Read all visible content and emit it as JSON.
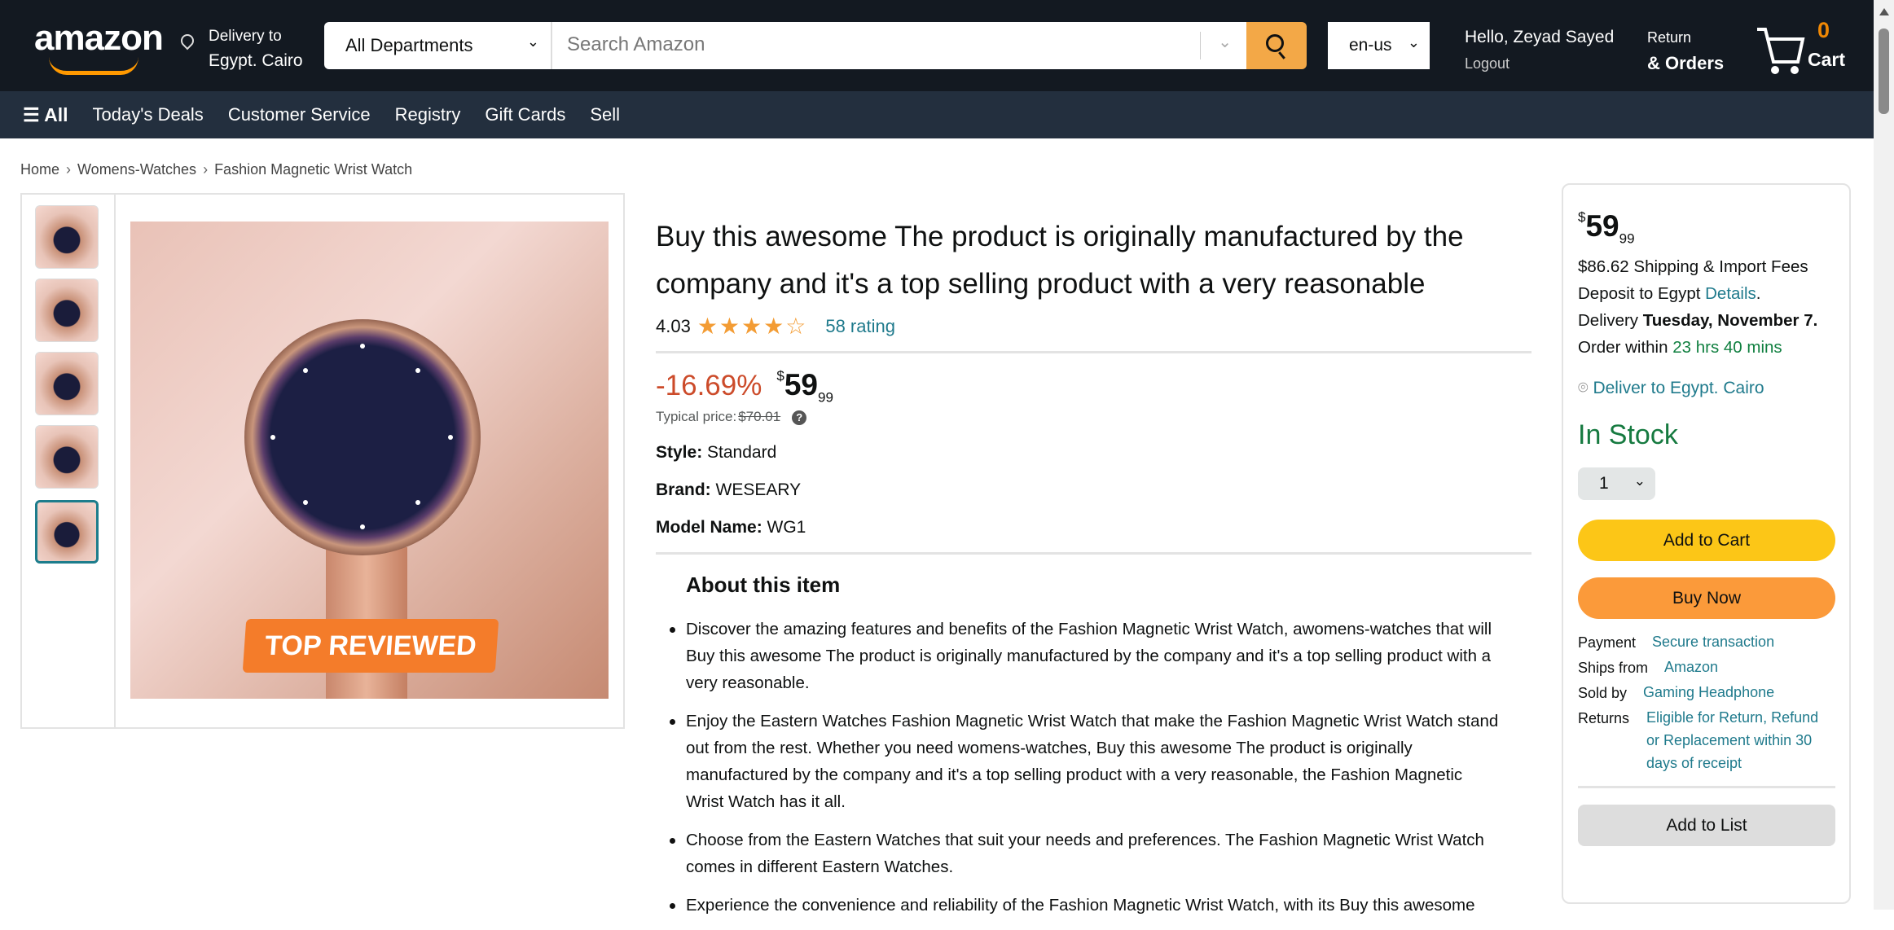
{
  "header": {
    "logo": "amazon",
    "delivery_line1": "Delivery to",
    "delivery_line2": "Egypt. Cairo",
    "department": "All Departments",
    "search_placeholder": "Search Amazon",
    "language": "en-us",
    "greeting": "Hello, Zeyad Sayed",
    "logout": "Logout",
    "returns_line1": "Return",
    "returns_line2": "& Orders",
    "cart_count": "0",
    "cart_label": "Cart"
  },
  "nav": {
    "all": "☰ All",
    "items": [
      "Today's Deals",
      "Customer Service",
      "Registry",
      "Gift Cards",
      "Sell"
    ]
  },
  "breadcrumb": [
    "Home",
    "Womens-Watches",
    "Fashion Magnetic Wrist Watch"
  ],
  "gallery": {
    "badge": "TOP REVIEWED",
    "thumbnail_count": 5,
    "selected_thumbnail": 5
  },
  "product": {
    "title": "Buy this awesome The product is originally manufactured by the company and it's a top selling product with a very reasonable",
    "rating": "4.03",
    "stars": "★★★★☆",
    "rating_count": "58 rating",
    "discount": "-16.69%",
    "currency": "$",
    "price_whole": "59",
    "price_fraction": "99",
    "typical_label": "Typical price:",
    "typical_price": "$70.01",
    "help": "?",
    "style_label": "Style:",
    "style": "Standard",
    "brand_label": "Brand:",
    "brand": "WESEARY",
    "model_label": "Model Name:",
    "model": "WG1",
    "about_heading": "About this item",
    "bullets": [
      "Discover the amazing features and benefits of the Fashion Magnetic Wrist Watch, awomens-watches that will Buy this awesome The product is originally manufactured by the company and it's a top selling product with a very reasonable.",
      "Enjoy the Eastern Watches Fashion Magnetic Wrist Watch that make the Fashion Magnetic Wrist Watch stand out from the rest. Whether you need womens-watches, Buy this awesome The product is originally manufactured by the company and it's a top selling product with a very reasonable, the Fashion Magnetic Wrist Watch has it all.",
      "Choose from the Eastern Watches that suit your needs and preferences. The Fashion Magnetic Wrist Watch comes in different Eastern Watches.",
      "Experience the convenience and reliability of the Fashion Magnetic Wrist Watch, with its Buy this awesome"
    ]
  },
  "buybox": {
    "currency": "$",
    "price_whole": "59",
    "price_fraction": "99",
    "shipping_text": "$86.62 Shipping & Import Fees Deposit to Egypt",
    "details": "Details",
    "delivery_label": "Delivery",
    "delivery_date": "Tuesday, November 7.",
    "order_within_label": "Order within",
    "order_within": "23 hrs 40 mins",
    "deliver_to": "Deliver to Egypt. Cairo",
    "stock": "In Stock",
    "quantity": "1",
    "add_to_cart": "Add to Cart",
    "buy_now": "Buy Now",
    "payment_label": "Payment",
    "payment": "Secure transaction",
    "ships_from_label": "Ships from",
    "ships_from": "Amazon",
    "sold_by_label": "Sold by",
    "sold_by": "Gaming Headphone",
    "returns_label": "Returns",
    "returns": "Eligible for Return, Refund or Replacement within 30 days of receipt",
    "add_to_list": "Add to List"
  },
  "colors": {
    "header": "#131921",
    "nav": "#232f3e",
    "accent": "#f3a847",
    "link": "#1f7a8c",
    "add_to_cart": "#fcc617",
    "buy_now": "#fb9a3a",
    "in_stock": "#167a40",
    "discount": "#cc4b2a"
  }
}
